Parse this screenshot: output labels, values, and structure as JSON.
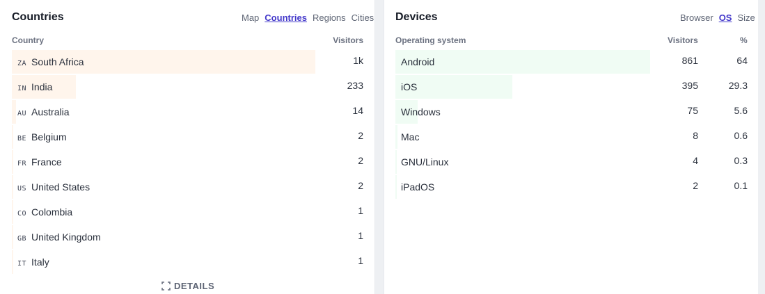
{
  "countries": {
    "title": "Countries",
    "tabs": [
      {
        "label": "Map",
        "active": false
      },
      {
        "label": "Countries",
        "active": true
      },
      {
        "label": "Regions",
        "active": false
      },
      {
        "label": "Cities",
        "active": false
      }
    ],
    "col_name": "Country",
    "col_visitors": "Visitors",
    "bar_color": "#fff5ec",
    "rows": [
      {
        "code": "ZA",
        "name": "South Africa",
        "visitors": "1k",
        "share": 1.0
      },
      {
        "code": "IN",
        "name": "India",
        "visitors": "233",
        "share": 0.21
      },
      {
        "code": "AU",
        "name": "Australia",
        "visitors": "14",
        "share": 0.013
      },
      {
        "code": "BE",
        "name": "Belgium",
        "visitors": "2",
        "share": 0.002
      },
      {
        "code": "FR",
        "name": "France",
        "visitors": "2",
        "share": 0.002
      },
      {
        "code": "US",
        "name": "United States",
        "visitors": "2",
        "share": 0.002
      },
      {
        "code": "CO",
        "name": "Colombia",
        "visitors": "1",
        "share": 0.001
      },
      {
        "code": "GB",
        "name": "United Kingdom",
        "visitors": "1",
        "share": 0.001
      },
      {
        "code": "IT",
        "name": "Italy",
        "visitors": "1",
        "share": 0.001
      }
    ],
    "details_label": "DETAILS"
  },
  "devices": {
    "title": "Devices",
    "tabs": [
      {
        "label": "Browser",
        "active": false
      },
      {
        "label": "OS",
        "active": true
      },
      {
        "label": "Size",
        "active": false
      }
    ],
    "col_name": "Operating system",
    "col_visitors": "Visitors",
    "col_percent": "%",
    "bar_color": "#f0fcf4",
    "rows": [
      {
        "name": "Android",
        "visitors": "861",
        "percent": "64",
        "share": 1.0
      },
      {
        "name": "iOS",
        "visitors": "395",
        "percent": "29.3",
        "share": 0.458
      },
      {
        "name": "Windows",
        "visitors": "75",
        "percent": "5.6",
        "share": 0.087
      },
      {
        "name": "Mac",
        "visitors": "8",
        "percent": "0.6",
        "share": 0.009
      },
      {
        "name": "GNU/Linux",
        "visitors": "4",
        "percent": "0.3",
        "share": 0.005
      },
      {
        "name": "iPadOS",
        "visitors": "2",
        "percent": "0.1",
        "share": 0.002
      }
    ]
  }
}
